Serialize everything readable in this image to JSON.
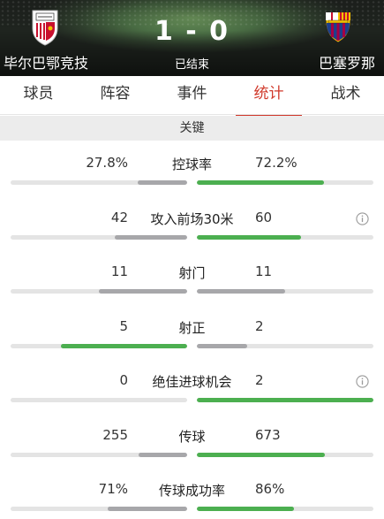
{
  "match": {
    "home_team": "毕尔巴鄂竞技",
    "away_team": "巴塞罗那",
    "score": "1 - 0",
    "status": "已结束"
  },
  "tabs": [
    {
      "label": "球员",
      "active": false
    },
    {
      "label": "阵容",
      "active": false
    },
    {
      "label": "事件",
      "active": false
    },
    {
      "label": "统计",
      "active": true
    },
    {
      "label": "战术",
      "active": false
    }
  ],
  "section": {
    "title": "关键"
  },
  "colors": {
    "accent": "#d0392b",
    "win_bar": "#4caf50",
    "lose_bar": "#a7a7aa",
    "track": "#e4e4e4"
  },
  "stats": [
    {
      "label": "控球率",
      "home": "27.8%",
      "away": "72.2%",
      "home_share": 0.278,
      "away_share": 0.722,
      "info": false
    },
    {
      "label": "攻入前场30米",
      "home": "42",
      "away": "60",
      "home_share": 0.41,
      "away_share": 0.59,
      "info": true
    },
    {
      "label": "射门",
      "home": "11",
      "away": "11",
      "home_share": 0.5,
      "away_share": 0.5,
      "info": false
    },
    {
      "label": "射正",
      "home": "5",
      "away": "2",
      "home_share": 0.714,
      "away_share": 0.286,
      "info": false
    },
    {
      "label": "绝佳进球机会",
      "home": "0",
      "away": "2",
      "home_share": 0.0,
      "away_share": 1.0,
      "info": true
    },
    {
      "label": "传球",
      "home": "255",
      "away": "673",
      "home_share": 0.275,
      "away_share": 0.725,
      "info": false
    },
    {
      "label": "传球成功率",
      "home": "71%",
      "away": "86%",
      "home_share": 0.45,
      "away_share": 0.55,
      "info": false
    }
  ]
}
